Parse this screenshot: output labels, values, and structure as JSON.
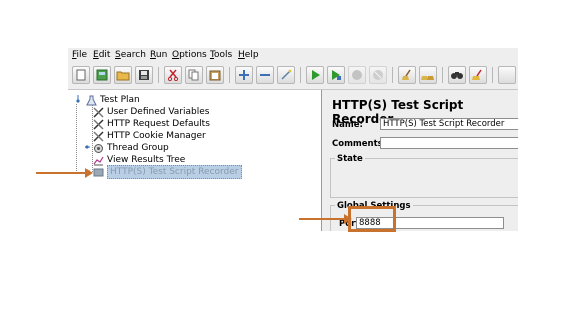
{
  "menubar": {
    "items": [
      {
        "pre": "",
        "u": "F",
        "post": "ile"
      },
      {
        "pre": "",
        "u": "E",
        "post": "dit"
      },
      {
        "pre": "",
        "u": "S",
        "post": "earch"
      },
      {
        "pre": "",
        "u": "R",
        "post": "un"
      },
      {
        "pre": "",
        "u": "O",
        "post": "ptions"
      },
      {
        "pre": "",
        "u": "T",
        "post": "ools"
      },
      {
        "pre": "",
        "u": "H",
        "post": "elp"
      }
    ]
  },
  "tree": {
    "root": "Test Plan",
    "items": [
      "User Defined Variables",
      "HTTP Request Defaults",
      "HTTP Cookie Manager",
      "Thread Group",
      "View Results Tree",
      "HTTP(S) Test Script Recorder"
    ]
  },
  "panel": {
    "title": "HTTP(S) Test Script Recorder",
    "name_label": "Name:",
    "name_value": "HTTP(S) Test Script Recorder",
    "comments_label": "Comments:",
    "comments_value": "",
    "state_label": "State",
    "global_settings_label": "Global Settings",
    "port_label": "Port:",
    "port_value": "8888"
  },
  "colors": {
    "annotation": "#c8722d",
    "selection": "#b8cfe5"
  }
}
